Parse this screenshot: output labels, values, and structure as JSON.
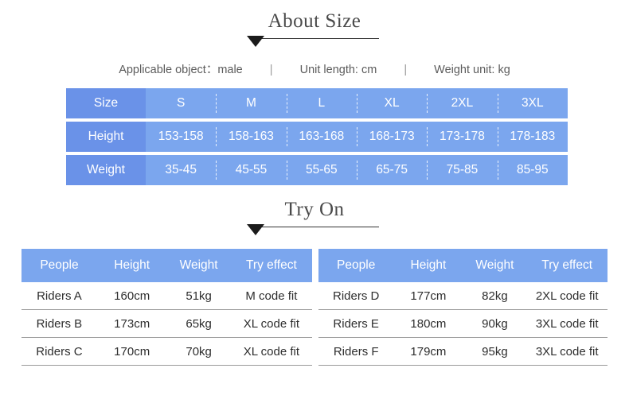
{
  "about": {
    "title": "About Size",
    "meta": [
      {
        "text": "Applicable object：male"
      },
      {
        "text": "Unit length: cm"
      },
      {
        "text": "Weight unit: kg"
      }
    ],
    "separator": "|",
    "size_table": {
      "row_labels": [
        "Size",
        "Height",
        "Weight"
      ],
      "sizes": [
        "S",
        "M",
        "L",
        "XL",
        "2XL",
        "3XL"
      ],
      "heights": [
        "153-158",
        "158-163",
        "163-168",
        "168-173",
        "173-178",
        "178-183"
      ],
      "weights": [
        "35-45",
        "45-55",
        "55-65",
        "65-75",
        "75-85",
        "85-95"
      ]
    }
  },
  "tryon": {
    "title": "Try On",
    "columns": [
      "People",
      "Height",
      "Weight",
      "Try effect"
    ],
    "left_rows": [
      {
        "people": "Riders A",
        "height": "160cm",
        "weight": "51kg",
        "effect": "M code fit"
      },
      {
        "people": "Riders B",
        "height": "173cm",
        "weight": "65kg",
        "effect": "XL code fit"
      },
      {
        "people": "Riders C",
        "height": "170cm",
        "weight": "70kg",
        "effect": "XL code fit"
      }
    ],
    "right_rows": [
      {
        "people": "Riders D",
        "height": "177cm",
        "weight": "82kg",
        "effect": "2XL code fit"
      },
      {
        "people": "Riders E",
        "height": "180cm",
        "weight": "90kg",
        "effect": "3XL code fit"
      },
      {
        "people": "Riders F",
        "height": "179cm",
        "weight": "95kg",
        "effect": "3XL code fit"
      }
    ]
  },
  "colors": {
    "label_blue": "#6a92e8",
    "cell_blue": "#7ba6ee",
    "heading_text": "#4a4a4a",
    "body_text": "#2e2e2e"
  }
}
